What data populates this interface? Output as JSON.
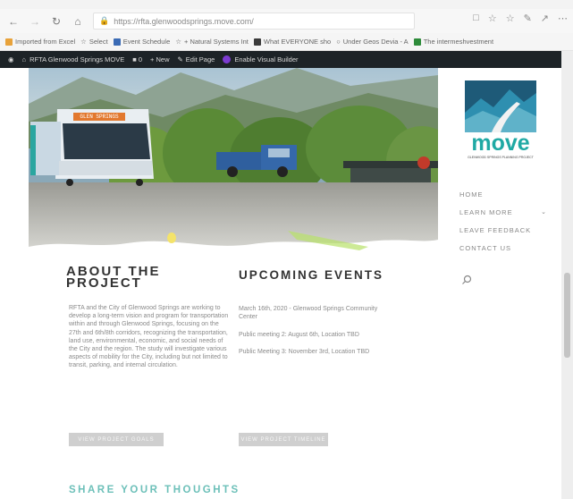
{
  "browser": {
    "url": "https://rfta.glenwoodsprings.move.com/",
    "bookmarks": [
      {
        "label": "Imported from Excel",
        "color": "#e8a23a"
      },
      {
        "label": "Select",
        "color": "#9a9a9a"
      },
      {
        "label": "Event Schedule",
        "color": "#3b6bb5"
      },
      {
        "label": "+ Natural Systems Int",
        "color": "#9a9a9a"
      },
      {
        "label": "What EVERYONE sho",
        "color": "#3b3b3b"
      },
      {
        "label": "Under Geos Devia - A",
        "color": "#9a9a9a"
      },
      {
        "label": "The intermeshvestment",
        "color": "#2e8b3a"
      }
    ]
  },
  "wpbar": {
    "site": "RFTA Glenwood Springs MOVE",
    "new_label": "+ New",
    "edit_label": "Edit Page",
    "builder_label": "Enable Visual Builder"
  },
  "hero": {
    "bus_sign": "GLEN SPRINGS"
  },
  "sidebar": {
    "logo_word": "move",
    "logo_tagline": "GLENWOOD SPRINGS PLANNING PROJECT",
    "menu": [
      {
        "label": "HOME"
      },
      {
        "label": "LEARN MORE",
        "has_submenu": true
      },
      {
        "label": "LEAVE FEEDBACK"
      },
      {
        "label": "CONTACT US"
      }
    ]
  },
  "about": {
    "title": "ABOUT THE PROJECT",
    "body": "RFTA and the City of Glenwood Springs are working to develop a long-term vision and program for transportation within and through Glenwood Springs, focusing on the 27th and 6th/8th corridors, recognizing the transportation, land use, environmental, economic, and social needs of the City and the region. The study will investigate various aspects of mobility for the City, including but not limited to transit, parking, and internal circulation.",
    "button": "VIEW PROJECT GOALS"
  },
  "events": {
    "title": "UPCOMING EVENTS",
    "items": [
      "March 16th, 2020 - Glenwood Springs Community Center",
      "Public meeting 2: August 6th, Location TBD",
      "Public Meeting 3: November 3rd, Location TBD"
    ],
    "button": "VIEW PROJECT TIMELINE"
  },
  "share": {
    "title": "SHARE YOUR THOUGHTS"
  }
}
